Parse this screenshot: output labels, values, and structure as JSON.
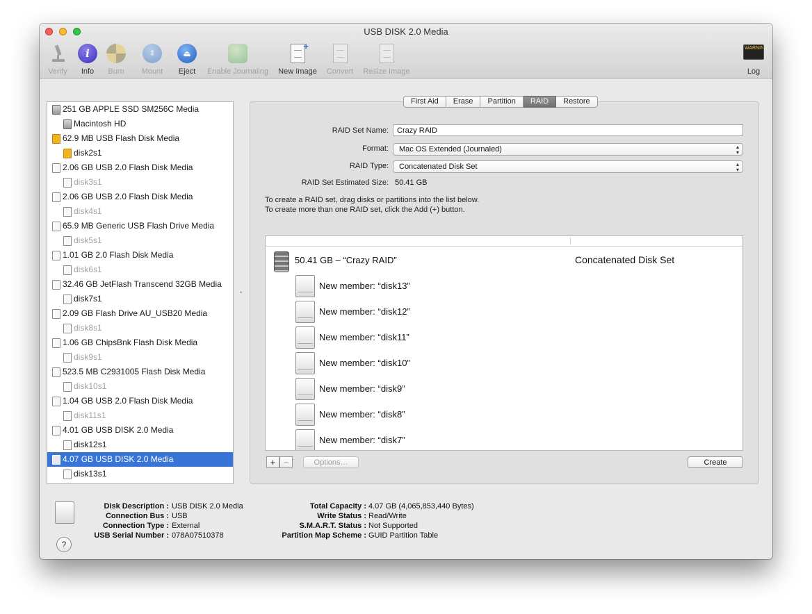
{
  "window": {
    "title": "USB DISK 2.0 Media"
  },
  "colors": {
    "close": "#fc5f57",
    "minimize": "#fdbc2e",
    "zoom": "#33c748",
    "selection": "#3875d7"
  },
  "toolbar": {
    "items": [
      {
        "label": "Verify",
        "icon": "microscope-icon",
        "enabled": false
      },
      {
        "label": "Info",
        "icon": "info-icon",
        "enabled": true
      },
      {
        "label": "Burn",
        "icon": "burn-disc-icon",
        "enabled": false
      },
      {
        "label": "Mount",
        "icon": "mount-icon",
        "enabled": false
      },
      {
        "label": "Eject",
        "icon": "eject-icon",
        "enabled": true
      },
      {
        "label": "Enable Journaling",
        "icon": "journaling-icon",
        "enabled": false
      },
      {
        "label": "New Image",
        "icon": "new-image-icon",
        "enabled": true
      },
      {
        "label": "Convert",
        "icon": "convert-icon",
        "enabled": false
      },
      {
        "label": "Resize Image",
        "icon": "resize-image-icon",
        "enabled": false
      }
    ],
    "log": {
      "label": "Log",
      "icon": "log-console-icon",
      "badge": "WARNIN"
    }
  },
  "sidebar": {
    "items": [
      {
        "label": "251 GB APPLE SSD SM256C Media",
        "level": 0,
        "icon": "ssd",
        "dim": false
      },
      {
        "label": "Macintosh HD",
        "level": 1,
        "icon": "ssd",
        "dim": false
      },
      {
        "label": "62.9 MB USB Flash Disk Media",
        "level": 0,
        "icon": "flash",
        "dim": false
      },
      {
        "label": "disk2s1",
        "level": 1,
        "icon": "flash",
        "dim": false
      },
      {
        "label": "2.06 GB USB 2.0 Flash Disk Media",
        "level": 0,
        "icon": "disk",
        "dim": false
      },
      {
        "label": "disk3s1",
        "level": 1,
        "icon": "disk",
        "dim": true
      },
      {
        "label": "2.06 GB USB 2.0 Flash Disk Media",
        "level": 0,
        "icon": "disk",
        "dim": false
      },
      {
        "label": "disk4s1",
        "level": 1,
        "icon": "disk",
        "dim": true
      },
      {
        "label": "65.9 MB Generic USB Flash Drive Media",
        "level": 0,
        "icon": "disk",
        "dim": false
      },
      {
        "label": "disk5s1",
        "level": 1,
        "icon": "disk",
        "dim": true
      },
      {
        "label": "1.01 GB 2.0 Flash Disk Media",
        "level": 0,
        "icon": "disk",
        "dim": false
      },
      {
        "label": "disk6s1",
        "level": 1,
        "icon": "disk",
        "dim": true
      },
      {
        "label": "32.46 GB JetFlash Transcend 32GB Media",
        "level": 0,
        "icon": "disk",
        "dim": false
      },
      {
        "label": "disk7s1",
        "level": 1,
        "icon": "disk",
        "dim": false
      },
      {
        "label": "2.09 GB Flash Drive AU_USB20 Media",
        "level": 0,
        "icon": "disk",
        "dim": false
      },
      {
        "label": "disk8s1",
        "level": 1,
        "icon": "disk",
        "dim": true
      },
      {
        "label": "1.06 GB ChipsBnk Flash Disk Media",
        "level": 0,
        "icon": "disk",
        "dim": false
      },
      {
        "label": "disk9s1",
        "level": 1,
        "icon": "disk",
        "dim": true
      },
      {
        "label": "523.5 MB C2931005 Flash Disk Media",
        "level": 0,
        "icon": "disk",
        "dim": false
      },
      {
        "label": "disk10s1",
        "level": 1,
        "icon": "disk",
        "dim": true
      },
      {
        "label": "1.04 GB USB 2.0 Flash Disk Media",
        "level": 0,
        "icon": "disk",
        "dim": false
      },
      {
        "label": "disk11s1",
        "level": 1,
        "icon": "disk",
        "dim": true
      },
      {
        "label": "4.01 GB USB DISK 2.0 Media",
        "level": 0,
        "icon": "disk",
        "dim": false
      },
      {
        "label": "disk12s1",
        "level": 1,
        "icon": "disk",
        "dim": false
      },
      {
        "label": "4.07 GB USB DISK 2.0 Media",
        "level": 0,
        "icon": "disk",
        "dim": false,
        "selected": true
      },
      {
        "label": "disk13s1",
        "level": 1,
        "icon": "disk",
        "dim": false
      }
    ]
  },
  "tabs": [
    {
      "label": "First Aid",
      "active": false
    },
    {
      "label": "Erase",
      "active": false
    },
    {
      "label": "Partition",
      "active": false
    },
    {
      "label": "RAID",
      "active": true
    },
    {
      "label": "Restore",
      "active": false
    }
  ],
  "raid": {
    "set_name_label": "RAID Set Name:",
    "set_name_value": "Crazy RAID",
    "format_label": "Format:",
    "format_value": "Mac OS Extended (Journaled)",
    "type_label": "RAID Type:",
    "type_value": "Concatenated Disk Set",
    "size_label": "RAID Set Estimated Size:",
    "size_value": "50.41 GB",
    "instruction1": "To create a RAID set, drag disks or partitions into the list below.",
    "instruction2": "To create more than one RAID set, click the Add (+) button.",
    "set_row": {
      "name": "50.41 GB – “Crazy RAID”",
      "type": "Concatenated Disk Set"
    },
    "members": [
      "New member: “disk13”",
      "New member: “disk12”",
      "New member: “disk11”",
      "New member: “disk10”",
      "New member: “disk9”",
      "New member: “disk8”",
      "New member: “disk7”"
    ],
    "add_label": "+",
    "remove_label": "−",
    "options_label": "Options…",
    "create_label": "Create"
  },
  "info": {
    "left": [
      {
        "key": "Disk Description :",
        "value": "USB DISK 2.0 Media"
      },
      {
        "key": "Connection Bus :",
        "value": "USB"
      },
      {
        "key": "Connection Type :",
        "value": "External"
      },
      {
        "key": "USB Serial Number :",
        "value": "078A07510378"
      }
    ],
    "right": [
      {
        "key": "Total Capacity :",
        "value": "4.07 GB (4,065,853,440 Bytes)"
      },
      {
        "key": "Write Status :",
        "value": "Read/Write"
      },
      {
        "key": "S.M.A.R.T. Status :",
        "value": "Not Supported"
      },
      {
        "key": "Partition Map Scheme :",
        "value": "GUID Partition Table"
      }
    ],
    "help_label": "?"
  }
}
